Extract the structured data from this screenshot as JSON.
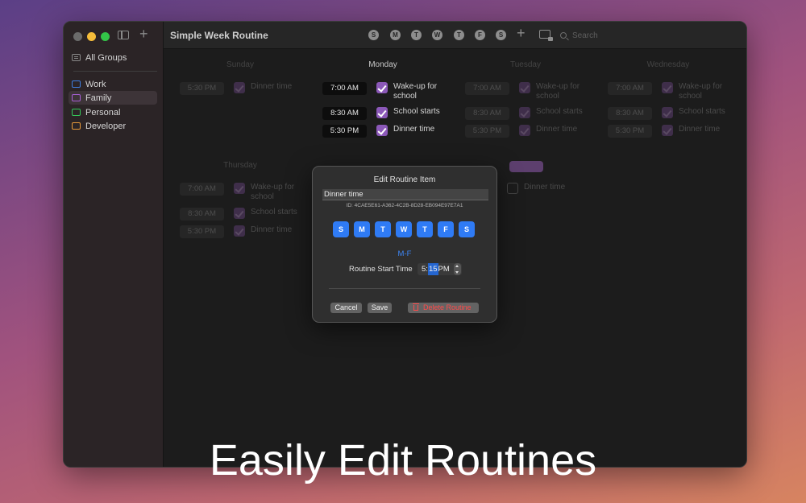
{
  "window": {
    "title": "Simple Week Routine"
  },
  "sidebar": {
    "all_groups": "All Groups",
    "groups": [
      {
        "label": "Work",
        "color": "#3f7ee0"
      },
      {
        "label": "Family",
        "color": "#a85fd6"
      },
      {
        "label": "Personal",
        "color": "#34c759"
      },
      {
        "label": "Developer",
        "color": "#e89a3a"
      }
    ],
    "selected": "Family"
  },
  "toolbar": {
    "day_filters": [
      "S",
      "M",
      "T",
      "W",
      "T",
      "F",
      "S"
    ],
    "search_placeholder": "Search"
  },
  "days": {
    "sunday": {
      "name": "Sunday",
      "items": [
        {
          "time": "5:30 PM",
          "label": "Dinner time"
        }
      ]
    },
    "monday": {
      "name": "Monday",
      "items": [
        {
          "time": "7:00 AM",
          "label": "Wake-up for school"
        },
        {
          "time": "8:30 AM",
          "label": "School starts"
        },
        {
          "time": "5:30 PM",
          "label": "Dinner time"
        }
      ]
    },
    "tuesday": {
      "name": "Tuesday",
      "items": [
        {
          "time": "7:00 AM",
          "label": "Wake-up for school"
        },
        {
          "time": "8:30 AM",
          "label": "School starts"
        },
        {
          "time": "5:30 PM",
          "label": "Dinner time"
        }
      ]
    },
    "wednesday": {
      "name": "Wednesday",
      "items": [
        {
          "time": "7:00 AM",
          "label": "Wake-up for school"
        },
        {
          "time": "8:30 AM",
          "label": "School starts"
        },
        {
          "time": "5:30 PM",
          "label": "Dinner time"
        }
      ]
    },
    "thursday": {
      "name": "Thursday",
      "items": [
        {
          "time": "7:00 AM",
          "label": "Wake-up for school"
        },
        {
          "time": "8:30 AM",
          "label": "School starts"
        },
        {
          "time": "5:30 PM",
          "label": "Dinner time"
        }
      ]
    },
    "saturday": {
      "items": [
        {
          "label": "Dinner time"
        }
      ]
    }
  },
  "dialog": {
    "title": "Edit Routine Item",
    "name_value": "Dinner time",
    "id_text": "ID: 4CAE5E61-A362-4C2B-8D28-EB094E97E7A1",
    "days": [
      "S",
      "M",
      "T",
      "W",
      "T",
      "F",
      "S"
    ],
    "days_summary": "M-F",
    "start_time_label": "Routine Start Time",
    "time_hour": "5:",
    "time_minute": "15",
    "time_ampm": " PM",
    "cancel": "Cancel",
    "save": "Save",
    "delete": "Delete Routine"
  },
  "caption": "Easily Edit Routines"
}
